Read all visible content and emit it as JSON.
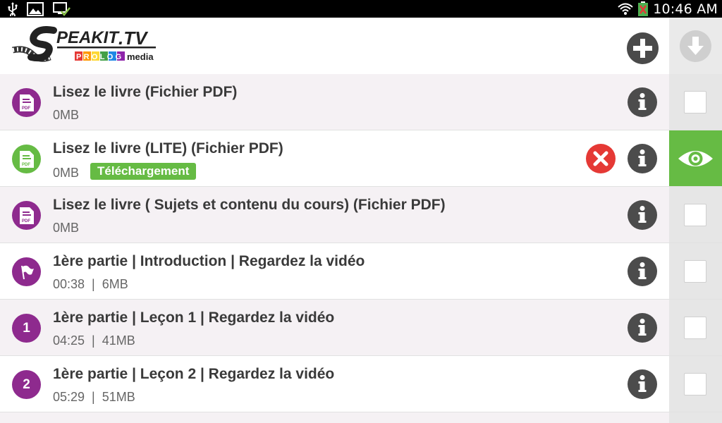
{
  "status_bar": {
    "time": "10:46 AM",
    "icons": [
      "usb-icon",
      "image-icon",
      "download-done-icon",
      "wifi-icon",
      "battery-icon"
    ]
  },
  "header": {
    "logo_text": "SPEAKIT.TV",
    "logo_subtext": "PROLOG media",
    "add_icon": "plus-icon",
    "download_all_icon": "download-arrow-icon"
  },
  "colors": {
    "accent_purple": "#8e2a8e",
    "accent_green": "#66bb44",
    "cancel_red": "#e53935",
    "icon_gray": "#4c4c4c"
  },
  "items": [
    {
      "type": "pdf",
      "title": "Lisez le livre (Fichier PDF)",
      "duration": "",
      "size": "0MB",
      "state": "none"
    },
    {
      "type": "pdf",
      "title": "Lisez le livre (LITE) (Fichier PDF)",
      "duration": "",
      "size": "0MB",
      "badge": "Téléchargement",
      "state": "downloading"
    },
    {
      "type": "pdf",
      "title": "Lisez le livre ( Sujets et contenu du cours) (Fichier PDF)",
      "duration": "",
      "size": "0MB",
      "state": "none"
    },
    {
      "type": "flag",
      "title": "1ère partie | Introduction | Regardez la vidéo",
      "duration": "00:38",
      "size": "6MB",
      "state": "none"
    },
    {
      "type": "number",
      "number": "1",
      "title": "1ère partie | Leçon 1 | Regardez la vidéo",
      "duration": "04:25",
      "size": "41MB",
      "state": "none"
    },
    {
      "type": "number",
      "number": "2",
      "title": "1ère partie | Leçon 2 | Regardez la vidéo",
      "duration": "05:29",
      "size": "51MB",
      "state": "none"
    }
  ]
}
